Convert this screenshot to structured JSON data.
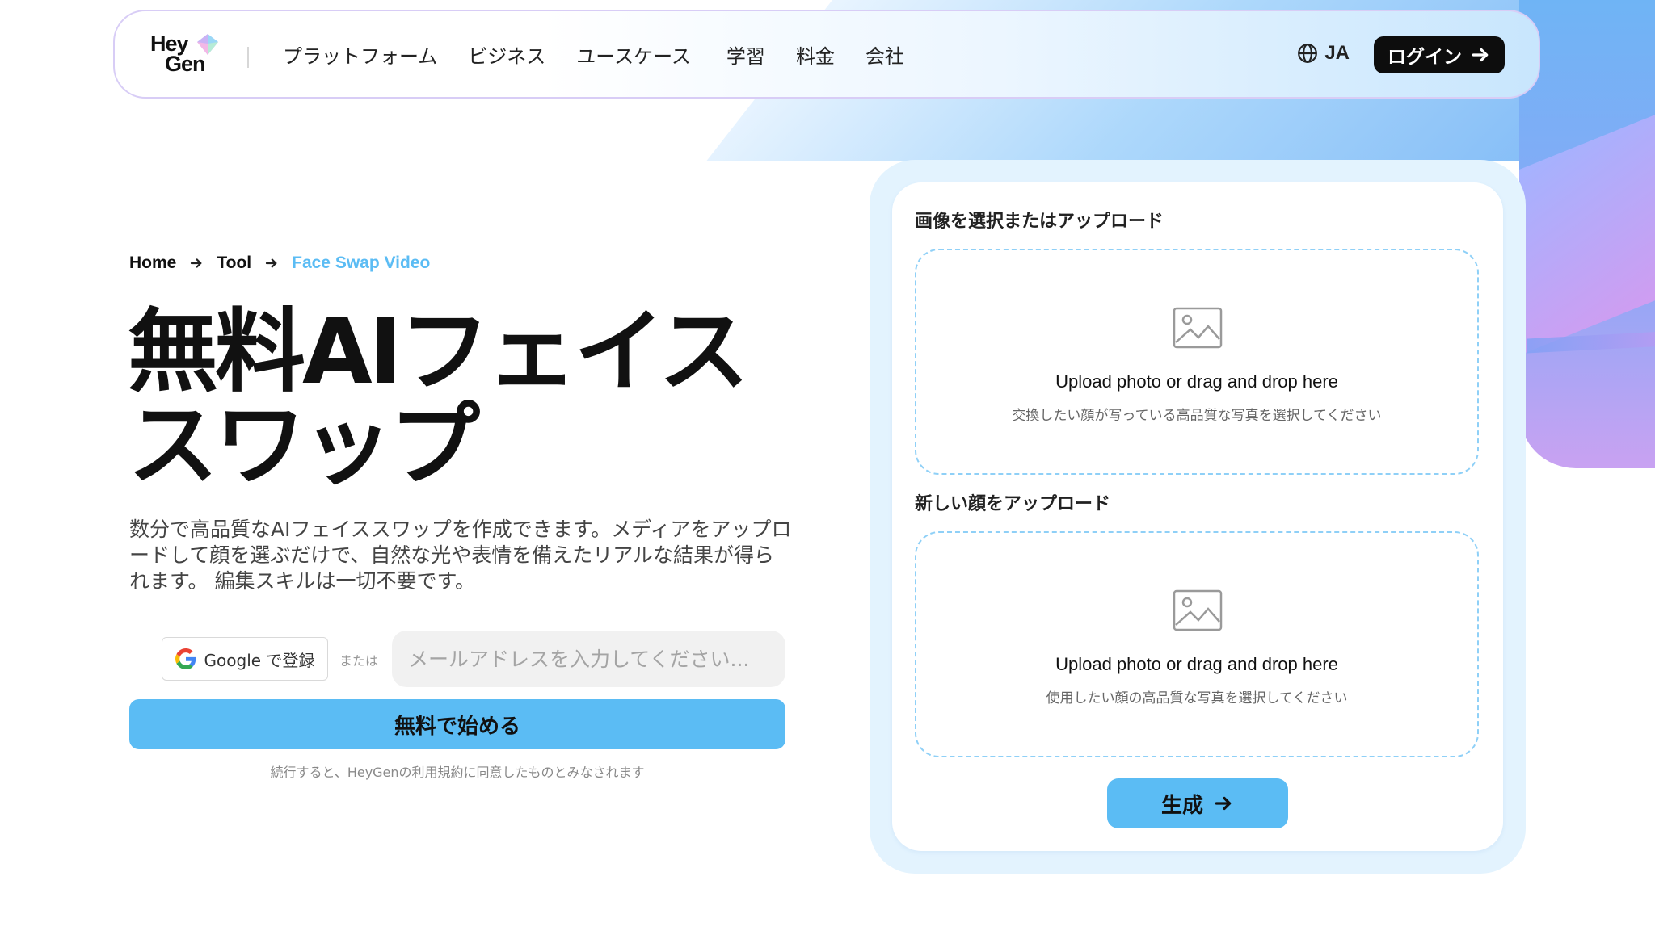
{
  "colors": {
    "accent": "#5bbcf4",
    "dark": "#0d0d0d",
    "dropzone_border": "#8fd0f7",
    "card_outer": "#e3f3fe"
  },
  "nav": {
    "logo_line1": "Hey",
    "logo_line2": "Gen",
    "links": [
      "プラットフォーム",
      "ビジネス",
      "ユースケース",
      "学習",
      "料金",
      "会社"
    ],
    "language": "JA",
    "language_icon": "globe-icon",
    "login_label": "ログイン",
    "login_icon": "arrow-right-icon"
  },
  "breadcrumb": [
    "Home",
    "Tool",
    "Face Swap Video"
  ],
  "hero": {
    "title_line1": "無料AIフェイス",
    "title_line2": "スワップ",
    "description": "数分で高品質なAIフェイススワップを作成できます。メディアをアップロードして顔を選ぶだけで、自然な光や表情を備えたリアルな結果が得られます。 編集スキルは一切不要です。"
  },
  "signup": {
    "google_label": "Google で登録",
    "or_label": "または",
    "email_placeholder": "メールアドレスを入力してください...",
    "email_value": "",
    "start_label": "無料で始める",
    "terms_prefix": "続行すると、",
    "terms_link": "HeyGenの利用規約",
    "terms_suffix": "に同意したものとみなされます"
  },
  "tool": {
    "section1_label": "画像を選択またはアップロード",
    "section1_title": "Upload photo or drag and drop here",
    "section1_sub": "交換したい顔が写っている高品質な写真を選択してください",
    "section2_label": "新しい顔をアップロード",
    "section2_title": "Upload photo or drag and drop here",
    "section2_sub": "使用したい顔の高品質な写真を選択してください",
    "generate_label": "生成",
    "upload_icon": "image-placeholder-icon"
  }
}
